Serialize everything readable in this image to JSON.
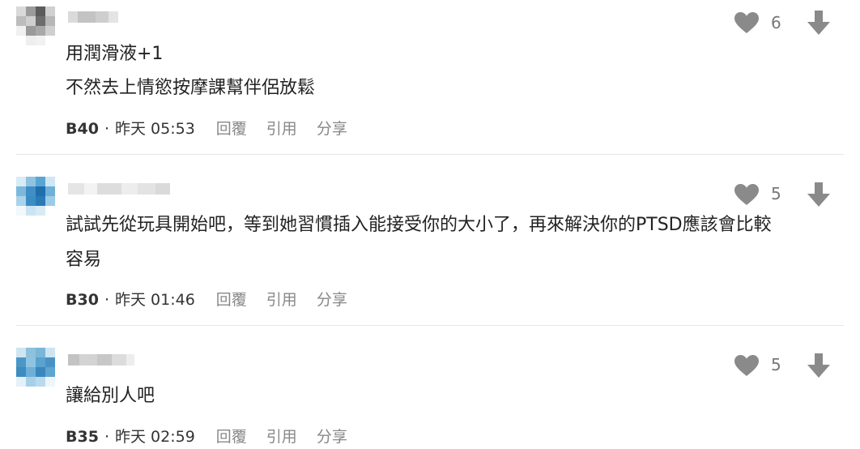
{
  "comments": [
    {
      "likes": "6",
      "lines": [
        "用潤滑液+1",
        "不然去上情慾按摩課幫伴侶放鬆"
      ],
      "floor": "B40",
      "time": "昨天 05:53"
    },
    {
      "likes": "5",
      "lines": [
        "試試先從玩具開始吧，等到她習慣插入能接受你的大小了，再來解決你的PTSD應該會比較",
        "容易"
      ],
      "floor": "B30",
      "time": "昨天 01:46"
    },
    {
      "likes": "5",
      "lines": [
        "讓給別人吧"
      ],
      "floor": "B35",
      "time": "昨天 02:59"
    }
  ],
  "actions": {
    "reply": "回覆",
    "quote": "引用",
    "share": "分享"
  },
  "separator": "·",
  "icons": {
    "like": "heart-icon",
    "dislike": "arrow-down-icon"
  },
  "colors": {
    "icon": "#8a8a8a",
    "text": "#222222",
    "muted": "#888888",
    "divider": "#e6e6e6"
  }
}
